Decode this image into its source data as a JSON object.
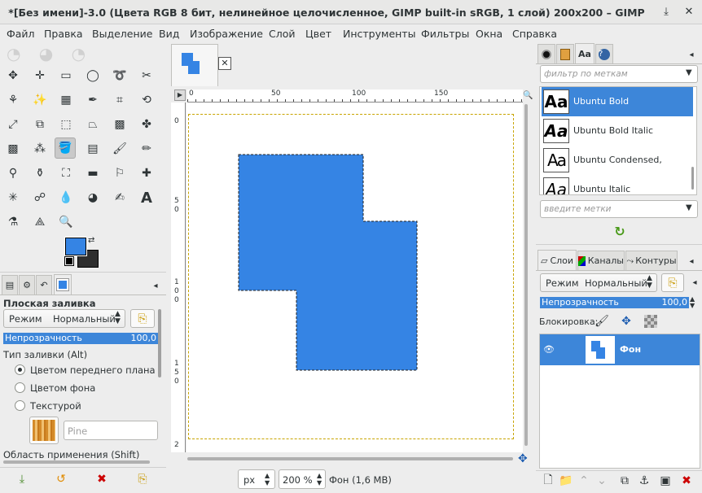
{
  "window": {
    "title": "*[Без имени]-3.0 (Цвета RGB 8 бит, нелинейное целочисленное, GIMP built-in sRGB, 1 слой) 200x200 – GIMP",
    "minimize_icon": "minimize-icon",
    "close_icon": "close-icon"
  },
  "menu": [
    "Файл",
    "Правка",
    "Выделение",
    "Вид",
    "Изображение",
    "Слой",
    "Цвет",
    "Инструменты",
    "Фильтры",
    "Окна",
    "Справка"
  ],
  "toolbox": {
    "tools": [
      "move",
      "align",
      "rect-select",
      "ellipse-select",
      "free-select",
      "fuzzy-select",
      "by-color-select",
      "scissors",
      "foreground-select",
      "paths",
      "warp-transform",
      "unified-transform",
      "scale",
      "rotate",
      "perspective",
      "handle-transform",
      "cage-transform",
      "flip",
      "crop",
      "gradient",
      "bucket-fill",
      "blend",
      "paintbrush",
      "pencil",
      "airbrush",
      "ink",
      "mypaint-brush",
      "eraser",
      "clone",
      "heal",
      "perspective-clone",
      "smudge",
      "blur",
      "dodge",
      "text",
      "color-picker",
      "measure",
      "zoom"
    ],
    "fg_color": "#3584e4",
    "bg_color": "#2e2e2e"
  },
  "tool_options": {
    "title": "Плоская заливка",
    "mode_label": "Режим",
    "mode_value": "Нормальный",
    "opacity_label": "Непрозрачность",
    "opacity_value": "100,0",
    "fill_type_label": "Тип заливки (Alt)",
    "fill_options": [
      "Цветом переднего плана",
      "Цветом фона",
      "Текстурой"
    ],
    "fill_selected": 0,
    "pattern_name": "Pine",
    "area_label": "Область применения (Shift)"
  },
  "canvas": {
    "ruler_top": [
      "0",
      "50",
      "100",
      "150"
    ],
    "ruler_left": [
      "0",
      "5\n0",
      "1\n0\n0",
      "1\n5\n0",
      "2"
    ],
    "shape_color": "#3584e4",
    "unit": "px",
    "zoom": "200 %",
    "status": "Фон (1,6 MB)"
  },
  "fonts_panel": {
    "filter_placeholder": "фильтр по меткам",
    "tags_placeholder": "введите метки",
    "fonts": [
      {
        "name": "Ubuntu Bold",
        "glyph": "Aa",
        "selected": true
      },
      {
        "name": "Ubuntu Bold Italic",
        "glyph": "Aa",
        "selected": false
      },
      {
        "name": "Ubuntu Condensed,",
        "glyph": "Aa",
        "selected": false
      },
      {
        "name": "Ubuntu Italic",
        "glyph": "Aa",
        "selected": false
      }
    ]
  },
  "layers_panel": {
    "tabs": [
      "Слои",
      "Каналы",
      "Контуры"
    ],
    "mode_label": "Режим",
    "mode_value": "Нормальный",
    "opacity_label": "Непрозрачность",
    "opacity_value": "100,0",
    "lock_label": "Блокировка:",
    "layer_name": "Фон"
  }
}
